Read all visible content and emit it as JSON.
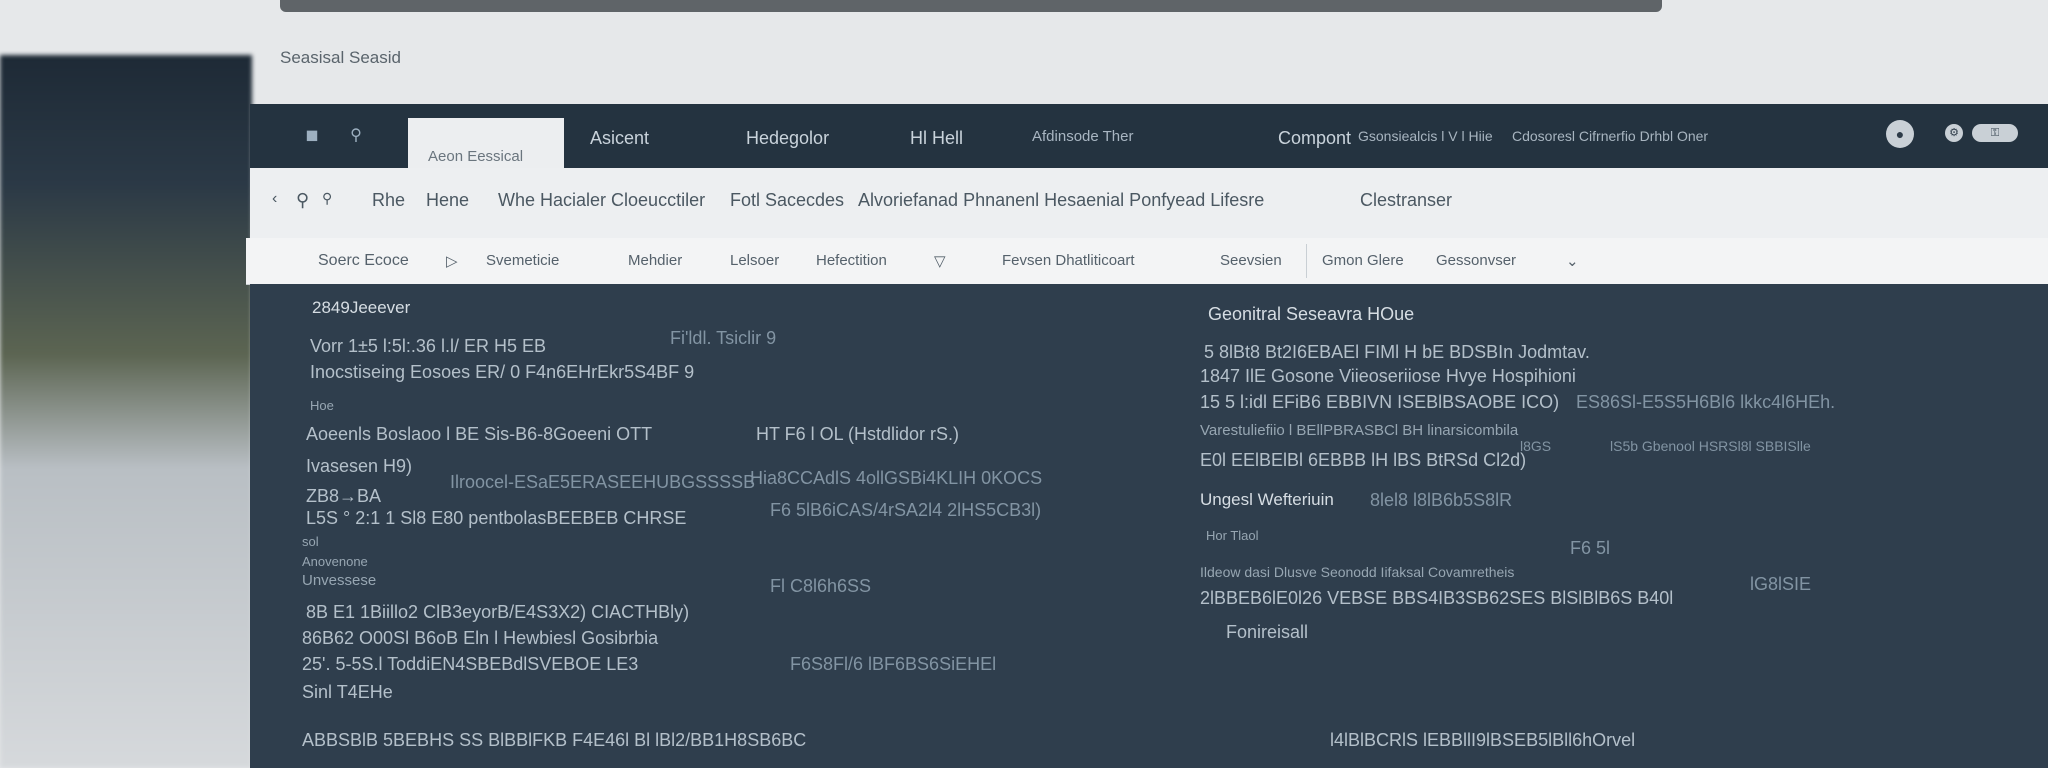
{
  "monitor_label": "Seasisal Seasid",
  "titlebar": {
    "active_tab": "Aeon Eessical",
    "items": [
      "Asicent",
      "Hedegolor",
      "Hl Hell",
      "Afdinsode Ther",
      "Compont",
      "Gsonsiealcis l V l Hiie",
      "Cdosoresl Cifrnerfio Drhbl Oner"
    ]
  },
  "navbar": {
    "items": [
      "Rhe",
      "Hene",
      "Whe Hacialer Cloeucctiler",
      "Fotl Sacecdes",
      "Alvoriefanad Phnanenl Hesaenial Ponfyead Lifesre",
      "Clestranser"
    ]
  },
  "toolbar": {
    "items": [
      "Soerc Ecoce",
      "Svemeticie",
      "Mehdier",
      "Lelsoer",
      "Hefectition",
      "Fevsen Dhatliticoart",
      "Seevsien",
      "Gmon Glere",
      "Gessonvser"
    ]
  },
  "left_panel": {
    "heading": "2849Jeeever",
    "rows": [
      "Vorr 1±5 l:5l:.36 l.l/ ER H5 EB",
      "Inocstiseing Eosoes ER/ 0 F4n6EHrEkr5S4BF 9",
      "Hoe",
      "Aoeenls Boslaoo l BE Sis-B6-8Goeeni OTT",
      "Ivasesen H9)",
      "Ilroocel-ESaE5ERASEEHUBGSSSSB",
      "ZB8→BA",
      "L5S ° 2:1 1 Sl8 E80 pentbolasBEEBEB CHRSE",
      "sol",
      "Anovenone",
      "Unvessese",
      "8B E1 1Biillo2 ClB3eyorB/E4S3X2) CIACTHBly)",
      "86B62 O00Sl B6oB Eln l Hewbiesl Gosibrbia",
      "25'. 5-5S.l ToddiEN4SBEBdlSVEBOE LE3",
      "Sinl T4EHe"
    ],
    "side_labels": [
      "Fi'ldl. Tsiclir 9",
      "HT F6 l OL (Hstdlidor rS.)",
      "Hia8CCAdlS 4ollGSBi4KLIH 0KOCS",
      "F6 5lB6iCAS/4rSA2l4 2lHS5CB3l)",
      "Fl C8l6h6SS",
      "F6S8Fl/6 lBF6BS6SiEHEl"
    ]
  },
  "right_panel": {
    "heading": "Geonitral Seseavra HOue",
    "rows": [
      "5 8lBt8 Bt2I6EBAEl FIMl H bE BDSBIn Jodmtav.",
      "1847 IlE Gosone Viieoseriiose Hvye Hospihioni",
      "15 5 l:idl EFiB6 EBBIVN ISEBlBSAOBE ICO)",
      "Varestuliefiio l BEllPBRASBCl BH linarsicombila",
      "E0l EElBElBl 6EBBB lH lBS BtRSd Cl2d)",
      "Ungesl Wefteriuin",
      "Hor Tlaol",
      "Ildeow dasi Dlusve Seonodd Iifaksal Covamretheis",
      "2lBBEB6lE0l26 VEBSE BBS4IB3SB62SES BlSlBlB6S B40l",
      "Fonireisall"
    ],
    "side_labels": [
      "ES86Sl-E5S5H6Bl6 lkkc4l6HEh.",
      "8lel8 l8lB6b5S8lR",
      "lS5b Gbenool HSRSl8l SBBISlle",
      "l8GS",
      "F6 5l",
      "lG8lSIE"
    ]
  },
  "footer_row": {
    "left": "ABBSBlB 5BEBHS SS BlBBlFKB F4E46l Bl lBl2/BB1H8SB6BC",
    "right": "l4lBlBCRlS lEBBllI9lBSEB5lBll6hOrvel"
  }
}
